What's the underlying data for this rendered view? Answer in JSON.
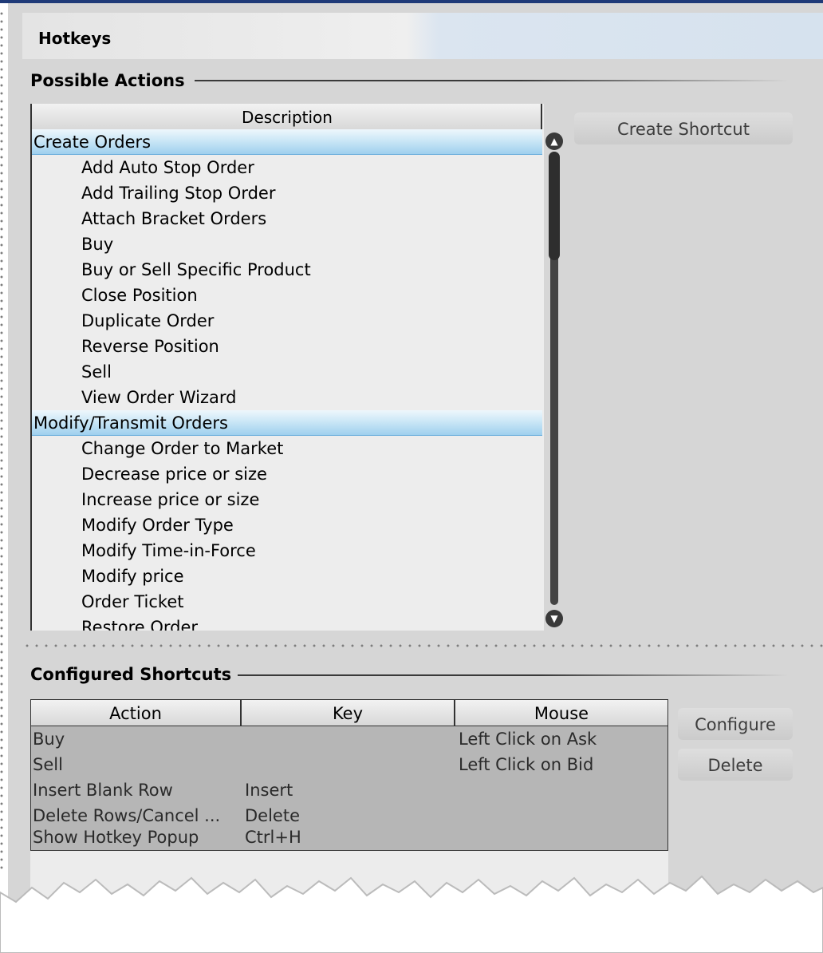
{
  "window": {
    "title": "Hotkeys"
  },
  "possible_actions": {
    "section_title": "Possible Actions",
    "column_header": "Description",
    "rows": [
      {
        "type": "category",
        "label": "Create Orders"
      },
      {
        "type": "item",
        "label": "Add Auto Stop Order"
      },
      {
        "type": "item",
        "label": "Add Trailing Stop Order"
      },
      {
        "type": "item",
        "label": "Attach Bracket Orders"
      },
      {
        "type": "item",
        "label": "Buy"
      },
      {
        "type": "item",
        "label": "Buy or Sell Specific Product"
      },
      {
        "type": "item",
        "label": "Close Position"
      },
      {
        "type": "item",
        "label": "Duplicate Order"
      },
      {
        "type": "item",
        "label": "Reverse Position"
      },
      {
        "type": "item",
        "label": "Sell"
      },
      {
        "type": "item",
        "label": "View Order Wizard"
      },
      {
        "type": "category",
        "label": "Modify/Transmit Orders"
      },
      {
        "type": "item",
        "label": "Change Order to Market"
      },
      {
        "type": "item",
        "label": "Decrease price or size"
      },
      {
        "type": "item",
        "label": "Increase price or size"
      },
      {
        "type": "item",
        "label": "Modify Order Type"
      },
      {
        "type": "item",
        "label": "Modify Time-in-Force"
      },
      {
        "type": "item",
        "label": "Modify price"
      },
      {
        "type": "item",
        "label": "Order Ticket"
      },
      {
        "type": "item",
        "label": "Restore Order"
      }
    ],
    "create_shortcut_label": "Create Shortcut",
    "scroll_up_icon": "scroll-up-icon",
    "scroll_down_icon": "scroll-down-icon"
  },
  "configured_shortcuts": {
    "section_title": "Configured Shortcuts",
    "columns": [
      "Action",
      "Key",
      "Mouse"
    ],
    "rows": [
      {
        "action": "Buy",
        "key": "",
        "mouse": "Left Click on Ask"
      },
      {
        "action": "Sell",
        "key": "",
        "mouse": "Left Click on Bid"
      },
      {
        "action": "Insert Blank Row",
        "key": "Insert",
        "mouse": ""
      },
      {
        "action": "Delete Rows/Cancel ...",
        "key": "Delete",
        "mouse": ""
      },
      {
        "action": "Show Hotkey Popup",
        "key": "Ctrl+H",
        "mouse": ""
      }
    ],
    "configure_label": "Configure",
    "delete_label": "Delete"
  },
  "colors": {
    "panel_bg": "#d6d6d6",
    "top_border": "#1f3a78",
    "category_highlight": "#9fd0ee"
  }
}
